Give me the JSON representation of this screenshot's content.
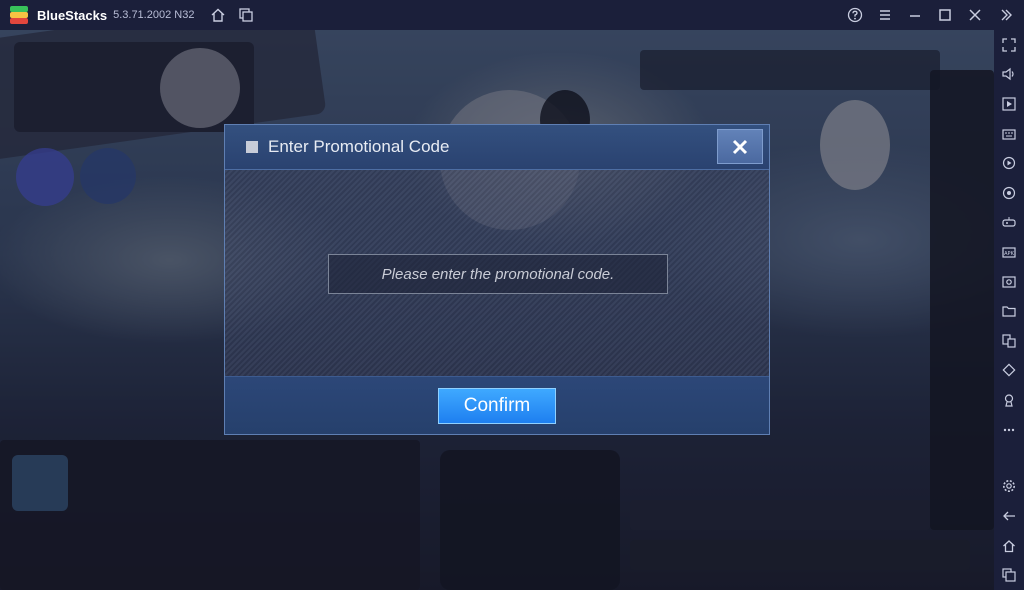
{
  "window": {
    "app_name": "BlueStacks",
    "version": "5.3.71.2002 N32"
  },
  "titlebar": {
    "left_icons": [
      "home-icon",
      "multi-instance-icon"
    ],
    "right_icons": [
      "help-icon",
      "menu-icon",
      "minimize-icon",
      "maximize-icon",
      "close-icon"
    ]
  },
  "sidebar": {
    "top_icons": [
      "fullscreen-icon",
      "volume-icon",
      "media-icon",
      "keyboard-icon",
      "record-icon",
      "macro-icon",
      "controls-icon",
      "install-apk-icon",
      "screenshot-icon",
      "folder-icon",
      "multi-instance-sync-icon",
      "rotate-icon",
      "location-icon",
      "more-icon"
    ],
    "bottom_icons": [
      "settings-icon",
      "back-icon",
      "home-icon",
      "recent-apps-icon"
    ]
  },
  "dialog": {
    "title": "Enter Promotional Code",
    "input_placeholder": "Please enter the promotional code.",
    "input_value": "",
    "confirm_label": "Confirm"
  },
  "colors": {
    "titlebar_bg": "#1b1f3a",
    "dialog_header": "#2a4270",
    "confirm_button": "#1e7ff0"
  }
}
